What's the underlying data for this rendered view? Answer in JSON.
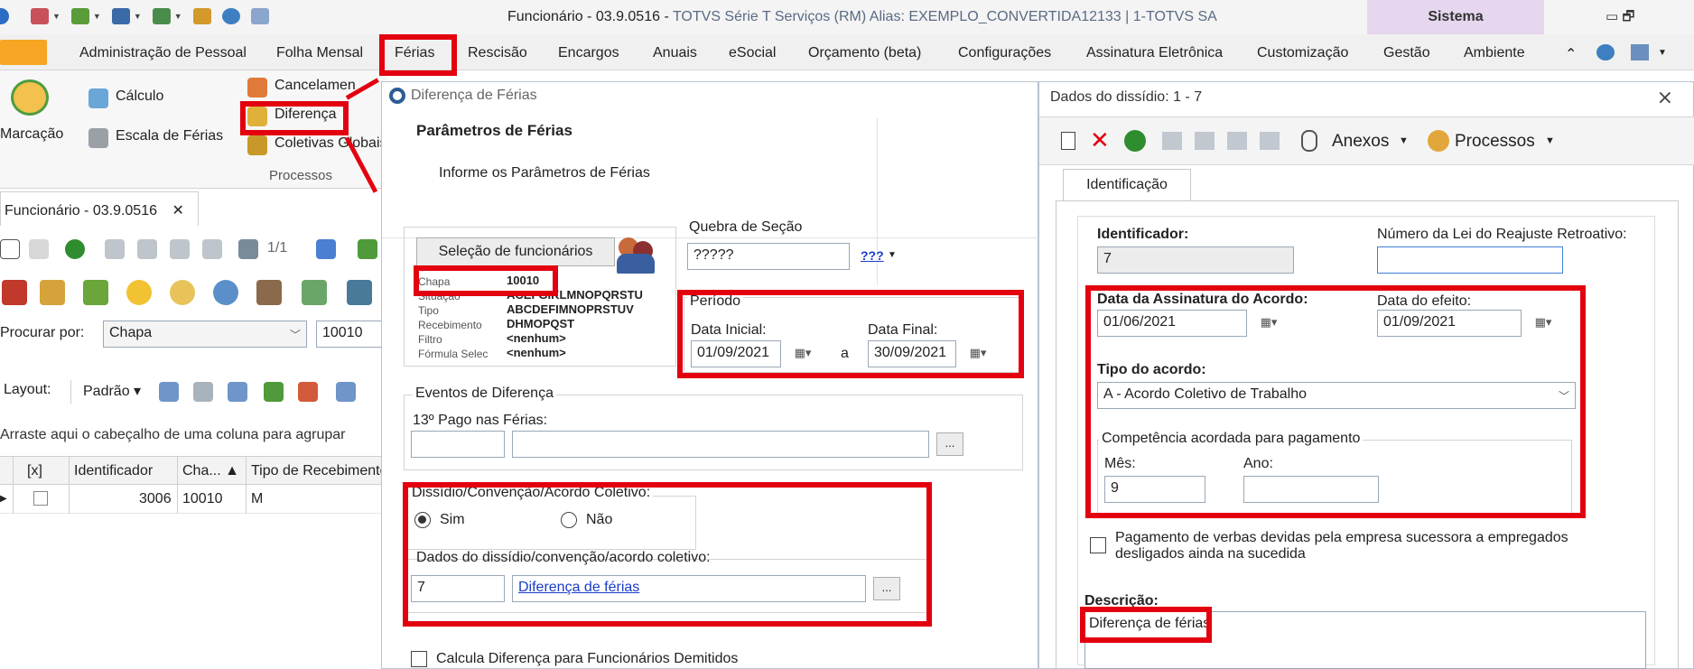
{
  "window": {
    "title_main": "Funcionário - 03.9.0516 - ",
    "title_app": "TOTVS Série T Serviços (RM) Alias: EXEMPLO_CONVERTIDA12133 | 1-TOTVS SA",
    "context_tab": "Sistema",
    "controls": "▭  🗗"
  },
  "menu": {
    "items": [
      "Administração de Pessoal",
      "Folha Mensal",
      "Férias",
      "Rescisão",
      "Encargos",
      "Anuais",
      "eSocial",
      "Orçamento (beta)",
      "Configurações",
      "Assinatura Eletrônica",
      "Customização",
      "Gestão",
      "Ambiente"
    ],
    "selected": "Férias"
  },
  "ribbon": {
    "marcacao": "Marcação",
    "calculo": "Cálculo",
    "escala": "Escala de Férias",
    "cancelamento": "Cancelamen",
    "diferenca": "Diferença",
    "coletivas": "Coletivas Globais",
    "group_label": "Processos"
  },
  "left": {
    "doc_tab": "Funcionário - 03.9.0516",
    "doc_tab_close": "✕",
    "pager": "1/1",
    "search_label": "Procurar por:",
    "search_field": "Chapa",
    "search_value": "10010",
    "layout_label": "Layout:",
    "layout_value": "Padrão ▾",
    "group_hint": "Arraste aqui o cabeçalho de uma coluna para agrupar",
    "columns": [
      "[x]",
      "Identificador",
      "Cha... ▲",
      "Tipo de Recebimento"
    ],
    "row": {
      "identificador": "3006",
      "chapa": "10010",
      "tipo": "M"
    }
  },
  "mid": {
    "title": "Diferença de Férias",
    "header_title": "Parâmetros de Férias",
    "header_sub": "Informe os Parâmetros de Férias",
    "btn_selecao": "Seleção de funcionários",
    "info": [
      {
        "label": "Chapa",
        "value": "10010"
      },
      {
        "label": "Situação",
        "value": "ACEFGIKLMNOPQRSTU"
      },
      {
        "label": "Tipo",
        "value": "ABCDEFIMNOPRSTUV"
      },
      {
        "label": "Recebimento",
        "value": "DHMOPQST"
      },
      {
        "label": "Filtro",
        "value": "<nenhum>"
      },
      {
        "label": "Fórmula Selec",
        "value": "<nenhum>"
      }
    ],
    "quebra_legend": "Quebra de Seção",
    "quebra_value": "?????",
    "quebra_btn": "???",
    "periodo_legend": "Período",
    "data_inicial_label": "Data Inicial:",
    "data_inicial": "01/09/2021",
    "a_label": "a",
    "data_final_label": "Data Final:",
    "data_final": "30/09/2021",
    "eventos_legend": "Eventos de Diferença",
    "pago_label": "13º Pago nas Férias:",
    "ellipsis": "...",
    "dissidio_legend": "Dissídio/Convenção/Acordo Coletivo:",
    "sim": "Sim",
    "nao": "Não",
    "dados_label": "Dados do dissídio/convenção/acordo coletivo:",
    "dados_code": "7",
    "dados_link": "Diferença de férias",
    "calc_demitidos": "Calcula Diferença para Funcionários Demitidos"
  },
  "right": {
    "title": "Dados do dissídio: 1 - 7",
    "close": "⨯",
    "anexos": "Anexos",
    "processos": "Processos",
    "tab": "Identificação",
    "identificador_label": "Identificador:",
    "identificador_value": "7",
    "lei_label": "Número da Lei do Reajuste Retroativo:",
    "lei_value": "",
    "assinatura_label": "Data da Assinatura do Acordo:",
    "assinatura_value": "01/06/2021",
    "efeito_label": "Data do efeito:",
    "efeito_value": "01/09/2021",
    "tipo_label": "Tipo do acordo:",
    "tipo_value": "A - Acordo Coletivo de Trabalho",
    "competencia_legend": "Competência acordada para pagamento",
    "mes_label": "Mês:",
    "mes_value": "9",
    "ano_label": "Ano:",
    "ano_value": "",
    "pagamento_line1": "Pagamento de verbas devidas pela empresa sucessora a empregados",
    "pagamento_line2": "desligados ainda na sucedida",
    "descricao_label": "Descrição:",
    "descricao_value": "Diferença de férias"
  },
  "colors": {
    "highlight": "#e3000f",
    "file_button": "#f6a623",
    "context_tab": "#e6d6ee",
    "link": "#1a3cc9"
  }
}
